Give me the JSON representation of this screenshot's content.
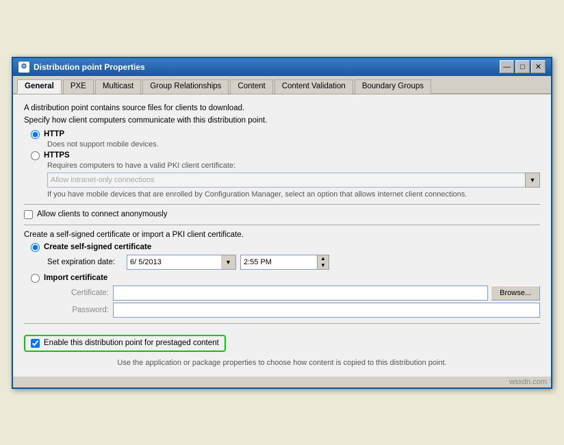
{
  "window": {
    "title": "Distribution point Properties",
    "icon": "⚙"
  },
  "tabs": [
    {
      "id": "general",
      "label": "General",
      "active": true
    },
    {
      "id": "pxe",
      "label": "PXE",
      "active": false
    },
    {
      "id": "multicast",
      "label": "Multicast",
      "active": false
    },
    {
      "id": "group-relationships",
      "label": "Group Relationships",
      "active": false
    },
    {
      "id": "content",
      "label": "Content",
      "active": false
    },
    {
      "id": "content-validation",
      "label": "Content Validation",
      "active": false
    },
    {
      "id": "boundary-groups",
      "label": "Boundary Groups",
      "active": false
    }
  ],
  "content": {
    "description1": "A distribution point contains source files for clients to download.",
    "description2": "Specify how client computers communicate with this distribution point.",
    "http_label": "HTTP",
    "http_note": "Does not support mobile devices.",
    "https_label": "HTTPS",
    "https_note": "Requires computers to have a valid PKI client certificate:",
    "dropdown_option": "Allow intranet-only connections",
    "mobile_note": "If you have mobile devices that are enrolled by Configuration Manager, select an option that allows Internet client connections.",
    "anon_label": "Allow clients to connect anonymously",
    "cert_section": "Create a self-signed certificate or import a PKI client certificate.",
    "create_cert_label": "Create self-signed certificate",
    "expiry_label": "Set expiration date:",
    "expiry_date": "6/ 5/2013",
    "expiry_time": "2:55 PM",
    "import_cert_label": "Import certificate",
    "certificate_label": "Certificate:",
    "password_label": "Password:",
    "browse_label": "Browse...",
    "prestaged_label": "Enable this distribution point for prestaged content",
    "bottom_text": "Use the application or package properties to choose how content is copied to this distribution point.",
    "watermark": "wsxdn.com"
  },
  "title_buttons": {
    "minimize": "—",
    "maximize": "□",
    "close": "✕"
  }
}
